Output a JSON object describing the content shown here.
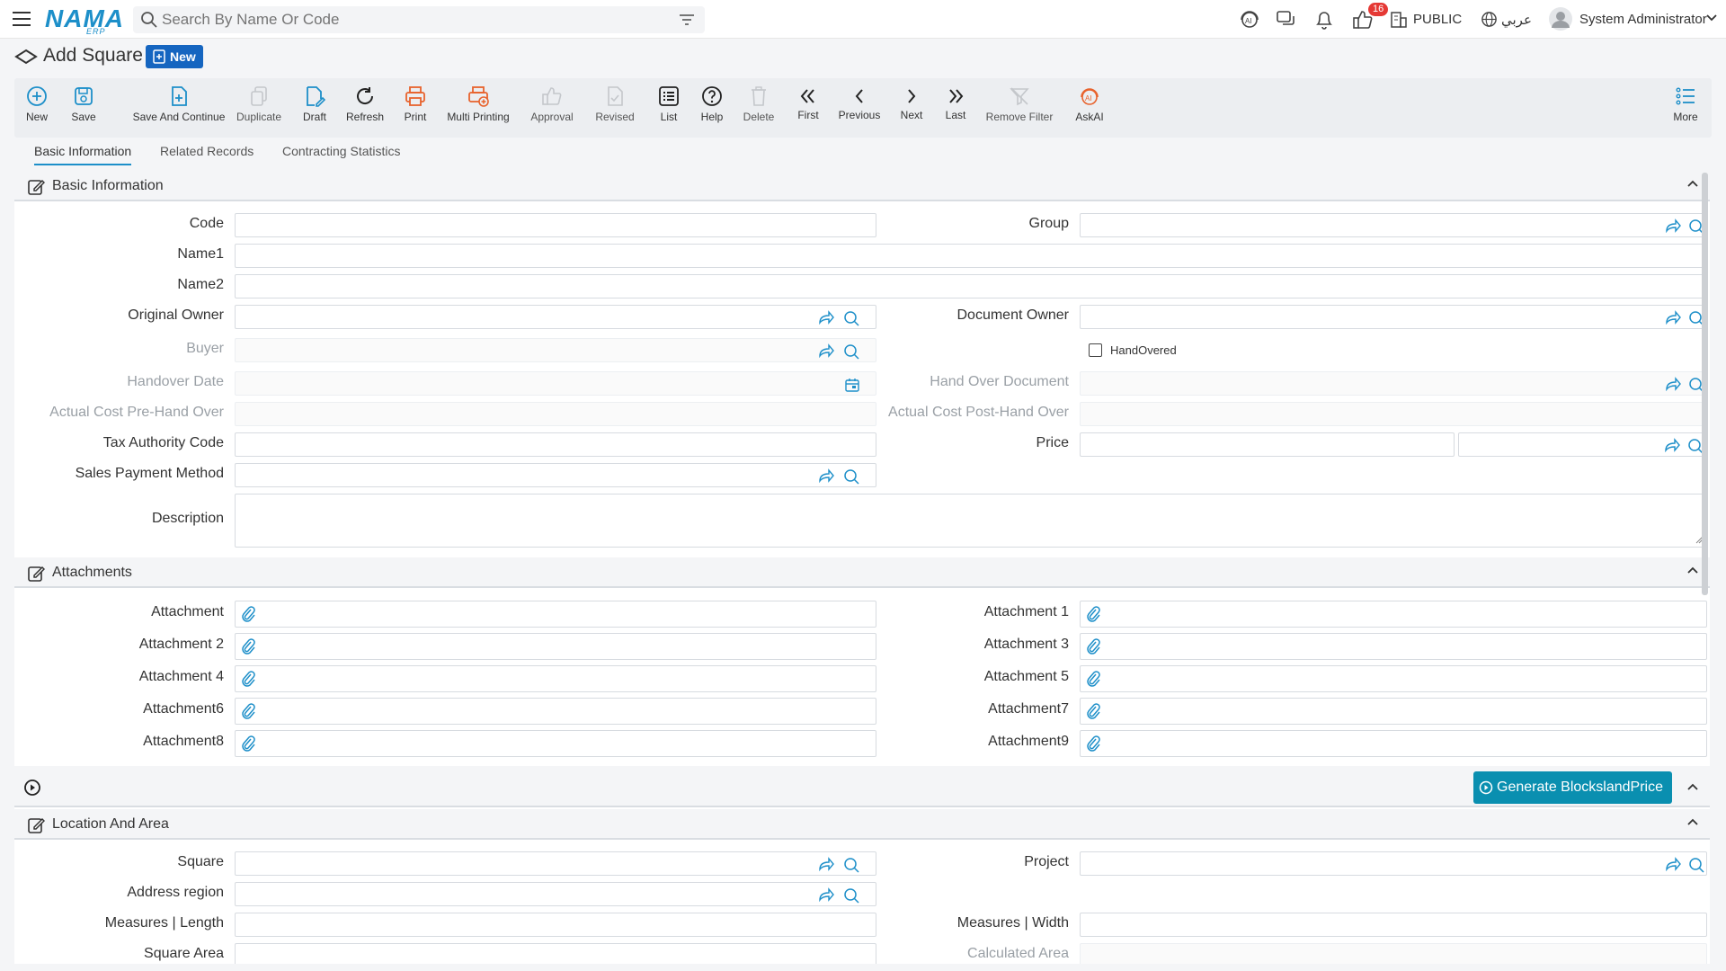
{
  "topbar": {
    "logo": "NAMA",
    "logo_sub": "ERP",
    "search_placeholder": "Search By Name Or Code",
    "notification_count": "16",
    "visibility": "PUBLIC",
    "language": "عربي",
    "user": "System Administrator"
  },
  "page": {
    "title": "Add Square",
    "badge": "New"
  },
  "toolbar": {
    "new": "New",
    "save": "Save",
    "save_continue": "Save And Continue",
    "duplicate": "Duplicate",
    "draft": "Draft",
    "refresh": "Refresh",
    "print": "Print",
    "multi_printing": "Multi Printing",
    "approval": "Approval",
    "revised": "Revised",
    "list": "List",
    "help": "Help",
    "delete": "Delete",
    "first": "First",
    "previous": "Previous",
    "next": "Next",
    "last": "Last",
    "remove_filter": "Remove Filter",
    "askai": "AskAI",
    "more": "More"
  },
  "tabs": [
    "Basic Information",
    "Related Records",
    "Contracting Statistics"
  ],
  "basic": {
    "title": "Basic Information",
    "code": "Code",
    "group": "Group",
    "name1": "Name1",
    "name2": "Name2",
    "original_owner": "Original Owner",
    "document_owner": "Document Owner",
    "buyer": "Buyer",
    "handovered": "HandOvered",
    "handover_date": "Handover Date",
    "hand_over_document": "Hand Over Document",
    "actual_pre": "Actual Cost Pre-Hand Over",
    "actual_post": "Actual Cost Post-Hand Over",
    "tax_code": "Tax Authority Code",
    "price": "Price",
    "sales_payment": "Sales Payment Method",
    "description": "Description"
  },
  "attachments": {
    "title": "Attachments",
    "a0": "Attachment",
    "a1": "Attachment 1",
    "a2": "Attachment 2",
    "a3": "Attachment 3",
    "a4": "Attachment 4",
    "a5": "Attachment 5",
    "a6": "Attachment6",
    "a7": "Attachment7",
    "a8": "Attachment8",
    "a9": "Attachment9"
  },
  "generate": {
    "button": "Generate BlockslandPrice"
  },
  "location": {
    "title": "Location And Area",
    "square": "Square",
    "project": "Project",
    "address_region": "Address region",
    "measures_length": "Measures | Length",
    "measures_width": "Measures | Width",
    "square_area": "Square Area",
    "calculated_area": "Calculated Area"
  },
  "colors": {
    "accent": "#1d8fc9",
    "badge_blue": "#1565c0",
    "generate_button": "#0a8fb0",
    "print_orange": "#e8622c",
    "notification_red": "#e53935"
  }
}
